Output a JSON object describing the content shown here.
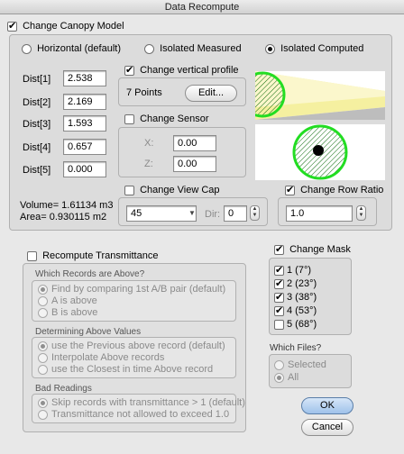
{
  "window": {
    "title": "Data Recompute"
  },
  "canopy": {
    "label": "Change Canopy Model",
    "radios": {
      "horizontal": "Horizontal (default)",
      "isolated_measured": "Isolated Measured",
      "isolated_computed": "Isolated Computed"
    },
    "dists": [
      {
        "label": "Dist[1]",
        "value": "2.538"
      },
      {
        "label": "Dist[2]",
        "value": "2.169"
      },
      {
        "label": "Dist[3]",
        "value": "1.593"
      },
      {
        "label": "Dist[4]",
        "value": "0.657"
      },
      {
        "label": "Dist[5]",
        "value": "0.000"
      }
    ],
    "vertical_profile": {
      "label": "Change vertical profile",
      "points": "7 Points",
      "edit": "Edit..."
    },
    "sensor": {
      "label": "Change Sensor",
      "x_label": "X:",
      "x_value": "0.00",
      "z_label": "Z:",
      "z_value": "0.00"
    },
    "volume": "Volume= 1.61134 m3",
    "area": "Area= 0.930115 m2",
    "view_cap": {
      "label": "Change View Cap",
      "value": "45",
      "dir_label": "Dir:",
      "dir_value": "0"
    },
    "row_ratio": {
      "label": "Change Row Ratio",
      "value": "1.0"
    }
  },
  "transmittance": {
    "label": "Recompute Transmittance",
    "records_above": {
      "title": "Which Records are Above?",
      "options": [
        "Find by comparing 1st A/B pair (default)",
        "A is above",
        "B is above"
      ]
    },
    "determining": {
      "title": "Determining Above Values",
      "options": [
        "use the Previous above record (default)",
        "Interpolate Above records",
        "use the Closest in time Above record"
      ]
    },
    "bad": {
      "title": "Bad Readings",
      "options": [
        "Skip records with transmittance > 1 (default)",
        "Transmittance not allowed to exceed 1.0"
      ]
    }
  },
  "mask": {
    "label": "Change Mask",
    "items": [
      {
        "label": "1 (7°)",
        "checked": true
      },
      {
        "label": "2 (23°)",
        "checked": true
      },
      {
        "label": "3 (38°)",
        "checked": true
      },
      {
        "label": "4 (53°)",
        "checked": true
      },
      {
        "label": "5 (68°)",
        "checked": false
      }
    ]
  },
  "files": {
    "title": "Which Files?",
    "selected": "Selected",
    "all": "All"
  },
  "buttons": {
    "ok": "OK",
    "cancel": "Cancel"
  },
  "colors": {
    "canopy_green": "#22dd22",
    "sky_yellow": "#f5f0a0"
  }
}
